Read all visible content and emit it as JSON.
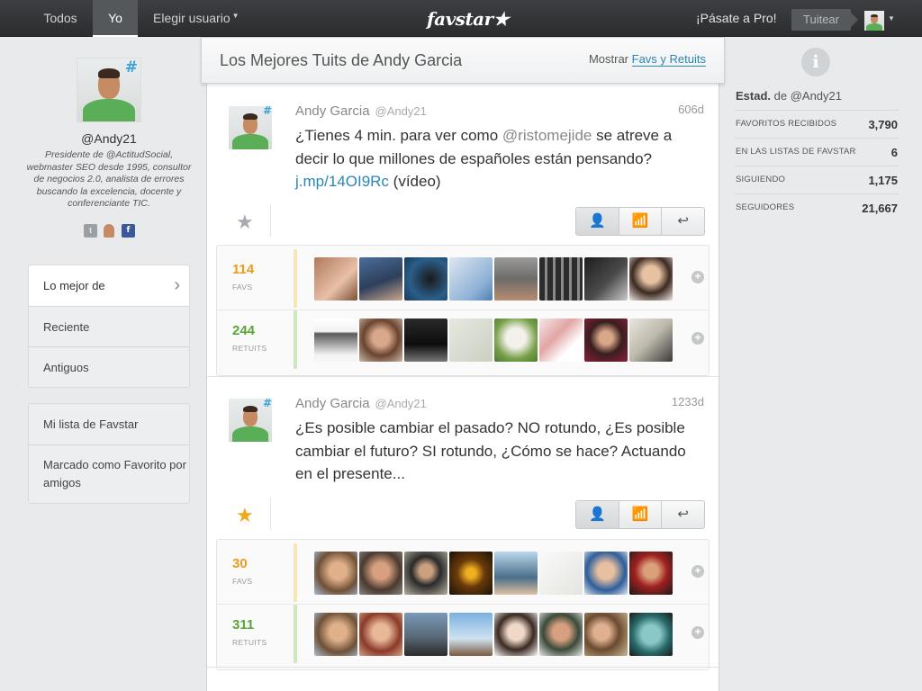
{
  "topbar": {
    "nav_todos": "Todos",
    "nav_yo": "Yo",
    "nav_elegir": "Elegir usuario",
    "logo": "favstar★",
    "pro": "¡Pásate a Pro!",
    "tuitear": "Tuitear"
  },
  "profile": {
    "handle": "@Andy21",
    "bio": "Presidente de @ActitudSocial, webmaster SEO desde 1995, consultor de negocios 2.0, analista de errores buscando la excelencia, docente y conferenciante TIC."
  },
  "menu1": {
    "items": [
      {
        "label": "Lo mejor de"
      },
      {
        "label": "Reciente"
      },
      {
        "label": "Antiguos"
      }
    ]
  },
  "menu2": {
    "items": [
      {
        "label": "Mi lista de Favstar"
      },
      {
        "label": "Marcado como Favorito por amigos"
      }
    ]
  },
  "center": {
    "title": "Los Mejores Tuits de Andy Garcia",
    "mostrar_label": "Mostrar",
    "mostrar_link": "Favs y Retuits"
  },
  "tweets": [
    {
      "name": "Andy Garcia",
      "username": "@Andy21",
      "age": "606d",
      "text_a": "¿Tienes 4 min. para ver como ",
      "mention": "@ristomejide",
      "text_b": " se atreve a decir lo que millones de españoles están pensando? ",
      "link": "j.mp/14OI9Rc",
      "text_c": " (vídeo)",
      "favs": "114",
      "favs_label": "FAVS",
      "retuits": "244",
      "retuits_label": "RETUITS",
      "starred": false
    },
    {
      "name": "Andy Garcia",
      "username": "@Andy21",
      "age": "1233d",
      "text_a": "¿Es posible cambiar el pasado? NO rotundo, ¿Es posible cambiar el futuro? SI rotundo, ¿Cómo se hace? Actuando en el presente...",
      "favs": "30",
      "favs_label": "FAVS",
      "retuits": "311",
      "retuits_label": "RETUITS",
      "starred": true
    }
  ],
  "sidebar_stats": {
    "title_bold": "Estad.",
    "title_rest": " de @Andy21",
    "rows": [
      {
        "label": "FAVORITOS RECIBIDOS",
        "value": "3,790"
      },
      {
        "label": "EN LAS LISTAS DE FAVSTAR",
        "value": "6"
      },
      {
        "label": "SIGUIENDO",
        "value": "1,175"
      },
      {
        "label": "SEGUIDORES",
        "value": "21,667"
      }
    ]
  },
  "colors": {
    "fav": "#eb9b1a",
    "retuit": "#5aa53a",
    "link": "#2a86b3",
    "star_active": "#f0a818",
    "star_inactive": "#a7abaf"
  },
  "icons": {
    "star": "star-icon",
    "user": "user-icon",
    "stats": "bar-chart-icon",
    "reply": "reply-icon",
    "info": "info-icon",
    "plus": "plus-icon",
    "chevron": "chevron-right-icon"
  }
}
